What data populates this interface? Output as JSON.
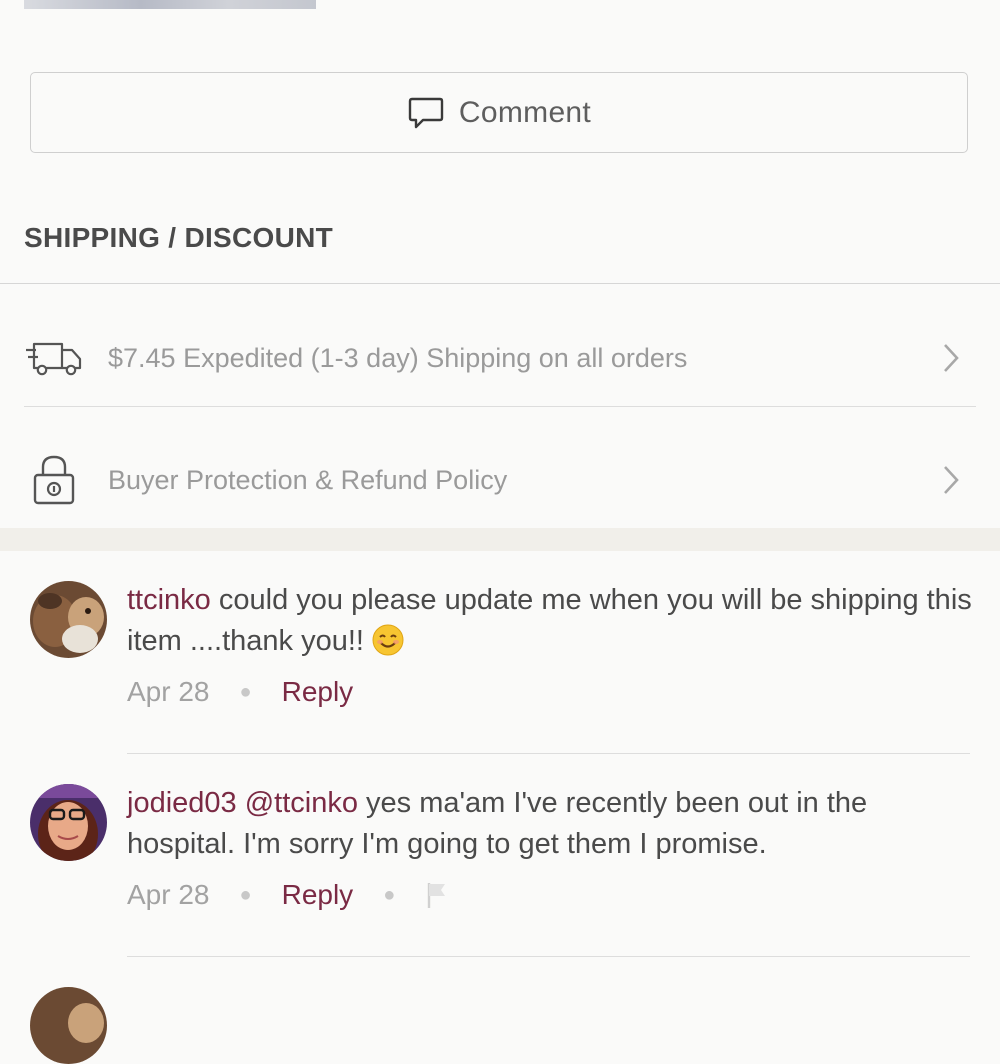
{
  "comment_button": {
    "label": "Comment",
    "icon": "speech-bubble-icon"
  },
  "shipping_section": {
    "title": "SHIPPING / DISCOUNT",
    "rows": [
      {
        "label": "$7.45 Expedited (1-3 day) Shipping on all orders",
        "icon": "truck-icon"
      },
      {
        "label": "Buyer Protection & Refund Policy",
        "icon": "lock-icon"
      }
    ]
  },
  "comments": [
    {
      "username": "ttcinko",
      "text": "could you please update me when you will be shipping this item ....thank you!!",
      "emoji": "smiling-face-emoji",
      "date": "Apr 28",
      "reply_label": "Reply"
    },
    {
      "username": "jodied03",
      "mention": "@ttcinko",
      "text": "yes ma'am I've recently been out in the hospital. I'm sorry I'm going to get them I promise.",
      "date": "Apr 28",
      "reply_label": "Reply",
      "flag_icon": "flag-icon"
    }
  ],
  "colors": {
    "username": "#7a2a44",
    "muted": "#a2a2a2",
    "background": "#fafaf9"
  }
}
